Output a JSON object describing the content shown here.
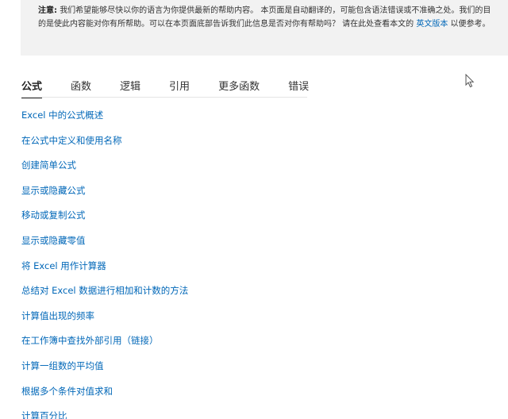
{
  "note": {
    "label": "注意:",
    "text_before_link": "我们希望能够尽快以你的语言为你提供最新的帮助内容。 本页面是自动翻译的，可能包含语法错误或不准确之处。我们的目的是使此内容能对你有所帮助。可以在本页面底部告诉我们此信息是否对你有帮助吗？ 请在此处查看本文的 ",
    "link_text": "英文版本",
    "text_after_link": " 以便参考。"
  },
  "tabs": [
    {
      "label": "公式",
      "active": true
    },
    {
      "label": "函数",
      "active": false
    },
    {
      "label": "逻辑",
      "active": false
    },
    {
      "label": "引用",
      "active": false
    },
    {
      "label": "更多函数",
      "active": false
    },
    {
      "label": "错误",
      "active": false
    }
  ],
  "links": [
    "Excel 中的公式概述",
    "在公式中定义和使用名称",
    "创建简单公式",
    "显示或隐藏公式",
    "移动或复制公式",
    "显示或隐藏零值",
    "将 Excel 用作计算器",
    "总结对 Excel 数据进行相加和计数的方法",
    "计算值出现的频率",
    "在工作簿中查找外部引用（链接）",
    "计算一组数的平均值",
    "根据多个条件对值求和",
    "计算百分比"
  ],
  "colors": {
    "link": "#0067b8",
    "note_background": "#f2f2f2",
    "text": "#333333"
  },
  "icons": {
    "cursor": "mouse-pointer-icon"
  }
}
